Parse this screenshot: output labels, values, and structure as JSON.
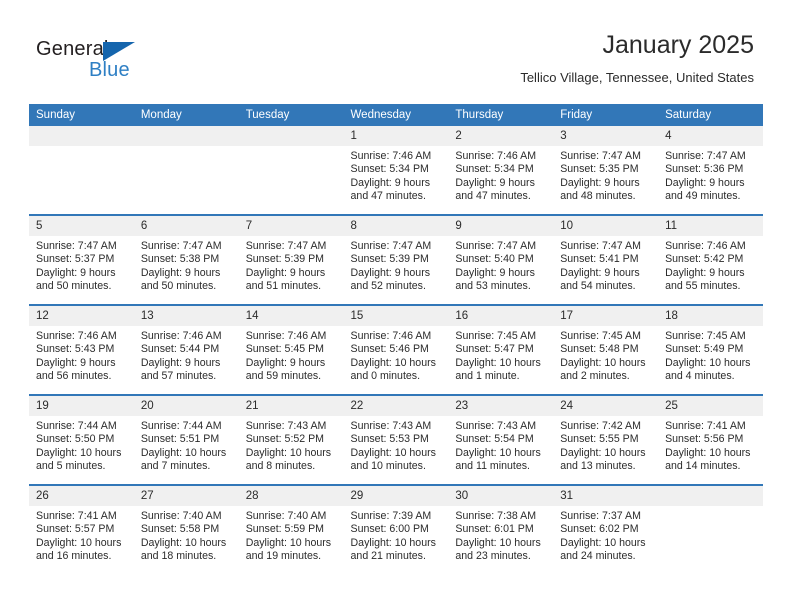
{
  "brand": {
    "name_part1": "General",
    "name_part2": "Blue",
    "triangle_color": "#1565ad",
    "blue_color": "#2e7fc4"
  },
  "header": {
    "title": "January 2025",
    "subtitle": "Tellico Village, Tennessee, United States"
  },
  "theme": {
    "header_blue": "#3277b8",
    "daynum_band": "#f0f0f0",
    "text": "#2b2b2b"
  },
  "weekday_headers": [
    "Sunday",
    "Monday",
    "Tuesday",
    "Wednesday",
    "Thursday",
    "Friday",
    "Saturday"
  ],
  "weeks": [
    [
      {
        "day": "",
        "blank": true,
        "lines": []
      },
      {
        "day": "",
        "blank": true,
        "lines": []
      },
      {
        "day": "",
        "blank": true,
        "lines": []
      },
      {
        "day": "1",
        "lines": [
          "Sunrise: 7:46 AM",
          "Sunset: 5:34 PM",
          "Daylight: 9 hours",
          "and 47 minutes."
        ]
      },
      {
        "day": "2",
        "lines": [
          "Sunrise: 7:46 AM",
          "Sunset: 5:34 PM",
          "Daylight: 9 hours",
          "and 47 minutes."
        ]
      },
      {
        "day": "3",
        "lines": [
          "Sunrise: 7:47 AM",
          "Sunset: 5:35 PM",
          "Daylight: 9 hours",
          "and 48 minutes."
        ]
      },
      {
        "day": "4",
        "lines": [
          "Sunrise: 7:47 AM",
          "Sunset: 5:36 PM",
          "Daylight: 9 hours",
          "and 49 minutes."
        ]
      }
    ],
    [
      {
        "day": "5",
        "lines": [
          "Sunrise: 7:47 AM",
          "Sunset: 5:37 PM",
          "Daylight: 9 hours",
          "and 50 minutes."
        ]
      },
      {
        "day": "6",
        "lines": [
          "Sunrise: 7:47 AM",
          "Sunset: 5:38 PM",
          "Daylight: 9 hours",
          "and 50 minutes."
        ]
      },
      {
        "day": "7",
        "lines": [
          "Sunrise: 7:47 AM",
          "Sunset: 5:39 PM",
          "Daylight: 9 hours",
          "and 51 minutes."
        ]
      },
      {
        "day": "8",
        "lines": [
          "Sunrise: 7:47 AM",
          "Sunset: 5:39 PM",
          "Daylight: 9 hours",
          "and 52 minutes."
        ]
      },
      {
        "day": "9",
        "lines": [
          "Sunrise: 7:47 AM",
          "Sunset: 5:40 PM",
          "Daylight: 9 hours",
          "and 53 minutes."
        ]
      },
      {
        "day": "10",
        "lines": [
          "Sunrise: 7:47 AM",
          "Sunset: 5:41 PM",
          "Daylight: 9 hours",
          "and 54 minutes."
        ]
      },
      {
        "day": "11",
        "lines": [
          "Sunrise: 7:46 AM",
          "Sunset: 5:42 PM",
          "Daylight: 9 hours",
          "and 55 minutes."
        ]
      }
    ],
    [
      {
        "day": "12",
        "lines": [
          "Sunrise: 7:46 AM",
          "Sunset: 5:43 PM",
          "Daylight: 9 hours",
          "and 56 minutes."
        ]
      },
      {
        "day": "13",
        "lines": [
          "Sunrise: 7:46 AM",
          "Sunset: 5:44 PM",
          "Daylight: 9 hours",
          "and 57 minutes."
        ]
      },
      {
        "day": "14",
        "lines": [
          "Sunrise: 7:46 AM",
          "Sunset: 5:45 PM",
          "Daylight: 9 hours",
          "and 59 minutes."
        ]
      },
      {
        "day": "15",
        "lines": [
          "Sunrise: 7:46 AM",
          "Sunset: 5:46 PM",
          "Daylight: 10 hours",
          "and 0 minutes."
        ]
      },
      {
        "day": "16",
        "lines": [
          "Sunrise: 7:45 AM",
          "Sunset: 5:47 PM",
          "Daylight: 10 hours",
          "and 1 minute."
        ]
      },
      {
        "day": "17",
        "lines": [
          "Sunrise: 7:45 AM",
          "Sunset: 5:48 PM",
          "Daylight: 10 hours",
          "and 2 minutes."
        ]
      },
      {
        "day": "18",
        "lines": [
          "Sunrise: 7:45 AM",
          "Sunset: 5:49 PM",
          "Daylight: 10 hours",
          "and 4 minutes."
        ]
      }
    ],
    [
      {
        "day": "19",
        "lines": [
          "Sunrise: 7:44 AM",
          "Sunset: 5:50 PM",
          "Daylight: 10 hours",
          "and 5 minutes."
        ]
      },
      {
        "day": "20",
        "lines": [
          "Sunrise: 7:44 AM",
          "Sunset: 5:51 PM",
          "Daylight: 10 hours",
          "and 7 minutes."
        ]
      },
      {
        "day": "21",
        "lines": [
          "Sunrise: 7:43 AM",
          "Sunset: 5:52 PM",
          "Daylight: 10 hours",
          "and 8 minutes."
        ]
      },
      {
        "day": "22",
        "lines": [
          "Sunrise: 7:43 AM",
          "Sunset: 5:53 PM",
          "Daylight: 10 hours",
          "and 10 minutes."
        ]
      },
      {
        "day": "23",
        "lines": [
          "Sunrise: 7:43 AM",
          "Sunset: 5:54 PM",
          "Daylight: 10 hours",
          "and 11 minutes."
        ]
      },
      {
        "day": "24",
        "lines": [
          "Sunrise: 7:42 AM",
          "Sunset: 5:55 PM",
          "Daylight: 10 hours",
          "and 13 minutes."
        ]
      },
      {
        "day": "25",
        "lines": [
          "Sunrise: 7:41 AM",
          "Sunset: 5:56 PM",
          "Daylight: 10 hours",
          "and 14 minutes."
        ]
      }
    ],
    [
      {
        "day": "26",
        "lines": [
          "Sunrise: 7:41 AM",
          "Sunset: 5:57 PM",
          "Daylight: 10 hours",
          "and 16 minutes."
        ]
      },
      {
        "day": "27",
        "lines": [
          "Sunrise: 7:40 AM",
          "Sunset: 5:58 PM",
          "Daylight: 10 hours",
          "and 18 minutes."
        ]
      },
      {
        "day": "28",
        "lines": [
          "Sunrise: 7:40 AM",
          "Sunset: 5:59 PM",
          "Daylight: 10 hours",
          "and 19 minutes."
        ]
      },
      {
        "day": "29",
        "lines": [
          "Sunrise: 7:39 AM",
          "Sunset: 6:00 PM",
          "Daylight: 10 hours",
          "and 21 minutes."
        ]
      },
      {
        "day": "30",
        "lines": [
          "Sunrise: 7:38 AM",
          "Sunset: 6:01 PM",
          "Daylight: 10 hours",
          "and 23 minutes."
        ]
      },
      {
        "day": "31",
        "lines": [
          "Sunrise: 7:37 AM",
          "Sunset: 6:02 PM",
          "Daylight: 10 hours",
          "and 24 minutes."
        ]
      },
      {
        "day": "",
        "blank": true,
        "lines": []
      }
    ]
  ]
}
